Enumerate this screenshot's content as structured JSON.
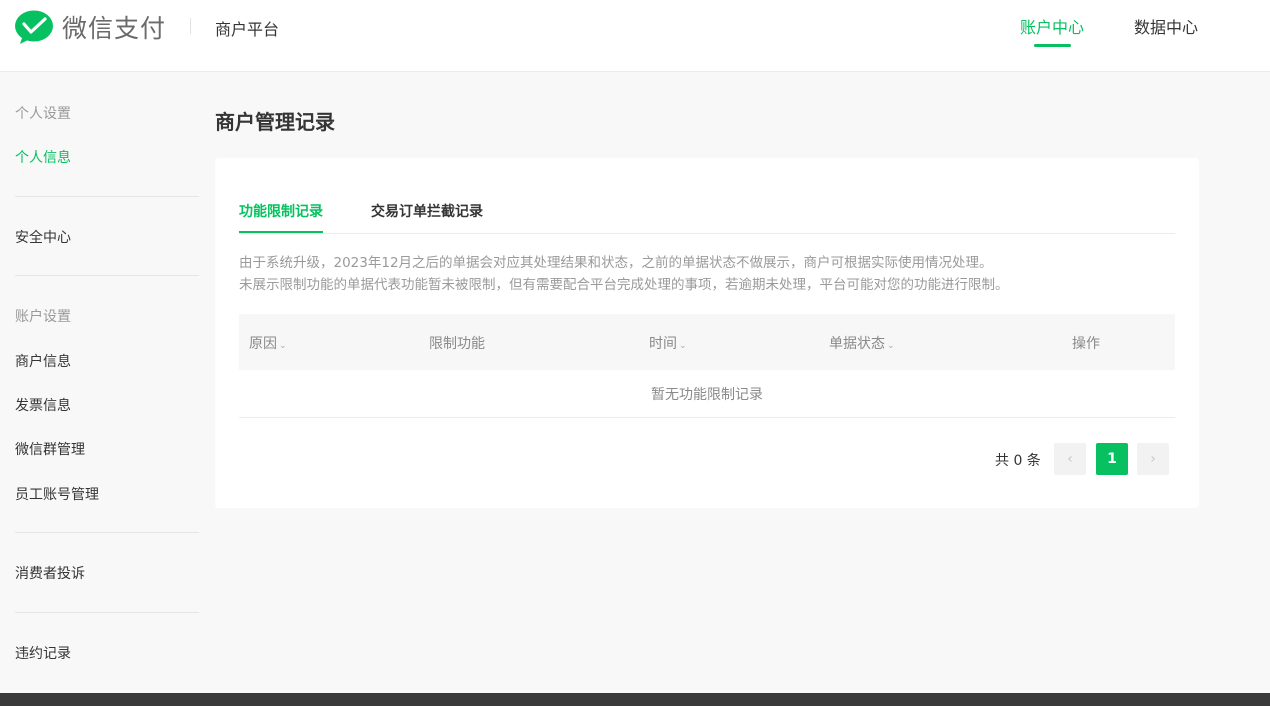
{
  "header": {
    "logo_text": "微信支付",
    "platform": "商户平台",
    "nav": [
      {
        "label": "账户中心",
        "active": true
      },
      {
        "label": "数据中心",
        "active": false
      }
    ]
  },
  "sidebar": {
    "group_personal": "个人设置",
    "item_profile": "个人信息",
    "item_security": "安全中心",
    "group_account": "账户设置",
    "item_merchant": "商户信息",
    "item_invoice": "发票信息",
    "item_wechat_group": "微信群管理",
    "item_staff": "员工账号管理",
    "item_complaints": "消费者投诉",
    "item_violations": "违约记录"
  },
  "main": {
    "title": "商户管理记录",
    "tabs": [
      {
        "label": "功能限制记录",
        "active": true
      },
      {
        "label": "交易订单拦截记录",
        "active": false
      }
    ],
    "notice_line1": "由于系统升级，2023年12月之后的单据会对应其处理结果和状态，之前的单据状态不做展示，商户可根据实际使用情况处理。",
    "notice_line2": "未展示限制功能的单据代表功能暂未被限制，但有需要配合平台完成处理的事项，若逾期未处理，平台可能对您的功能进行限制。",
    "table": {
      "columns": [
        "原因",
        "限制功能",
        "时间",
        "单据状态",
        "操作"
      ],
      "empty_text": "暂无功能限制记录"
    },
    "pagination": {
      "total_label": "共 0 条",
      "prev": "‹",
      "current_page": "1",
      "next": "›"
    }
  },
  "colors": {
    "accent": "#07c160",
    "text": "#353535",
    "muted": "#9a9a9a",
    "background": "#f8f8f8",
    "footer": "#3a3a3a"
  },
  "icons": {
    "logo": "wechat-pay-logo-icon",
    "sort": "chevron-down-icon",
    "prev": "chevron-left-icon",
    "next": "chevron-right-icon"
  }
}
